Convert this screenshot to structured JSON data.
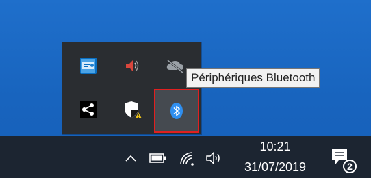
{
  "tooltip": {
    "text": "Périphériques Bluetooth"
  },
  "tray_overflow": {
    "icons": [
      "intel-graphics-icon",
      "speaker-icon",
      "onedrive-cloud-icon",
      "share-nodes-icon",
      "windows-security-warning-icon",
      "bluetooth-icon"
    ],
    "highlighted": "bluetooth-icon",
    "highlight_color": "#e02020"
  },
  "taskbar": {
    "time": "10:21",
    "date": "31/07/2019",
    "notification_count": "2",
    "icons": [
      "chevron-up-icon",
      "battery-icon",
      "wifi-icon",
      "volume-icon",
      "action-center-icon"
    ]
  }
}
